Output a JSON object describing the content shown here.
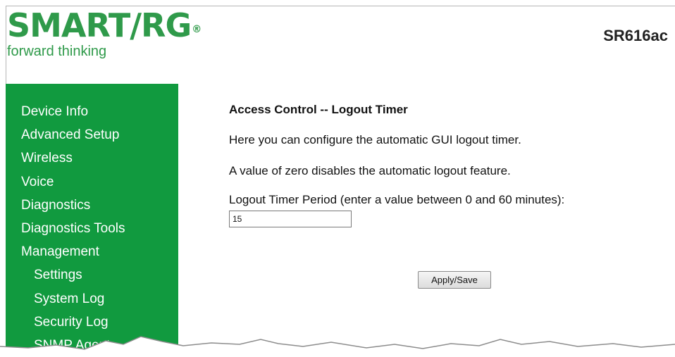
{
  "brand": {
    "logo_text": "SMART/RG",
    "logo_reg": "®",
    "tagline": "forward thinking",
    "model": "SR616ac",
    "color": "#2f9a4a"
  },
  "sidebar": {
    "background": "#119a3f",
    "items": [
      {
        "label": "Device Info"
      },
      {
        "label": "Advanced Setup"
      },
      {
        "label": "Wireless"
      },
      {
        "label": "Voice"
      },
      {
        "label": "Diagnostics"
      },
      {
        "label": "Diagnostics Tools"
      },
      {
        "label": "Management"
      },
      {
        "label": "Settings"
      },
      {
        "label": "System Log"
      },
      {
        "label": "Security Log"
      },
      {
        "label": "SNMP Agent"
      }
    ]
  },
  "main": {
    "title": "Access Control -- Logout Timer",
    "line1": "Here you can configure the automatic GUI logout timer.",
    "line2": "A value of zero disables the automatic logout feature.",
    "field_label": "Logout Timer Period (enter a value between 0 and 60 minutes):",
    "field_value": "15",
    "apply_label": "Apply/Save"
  }
}
